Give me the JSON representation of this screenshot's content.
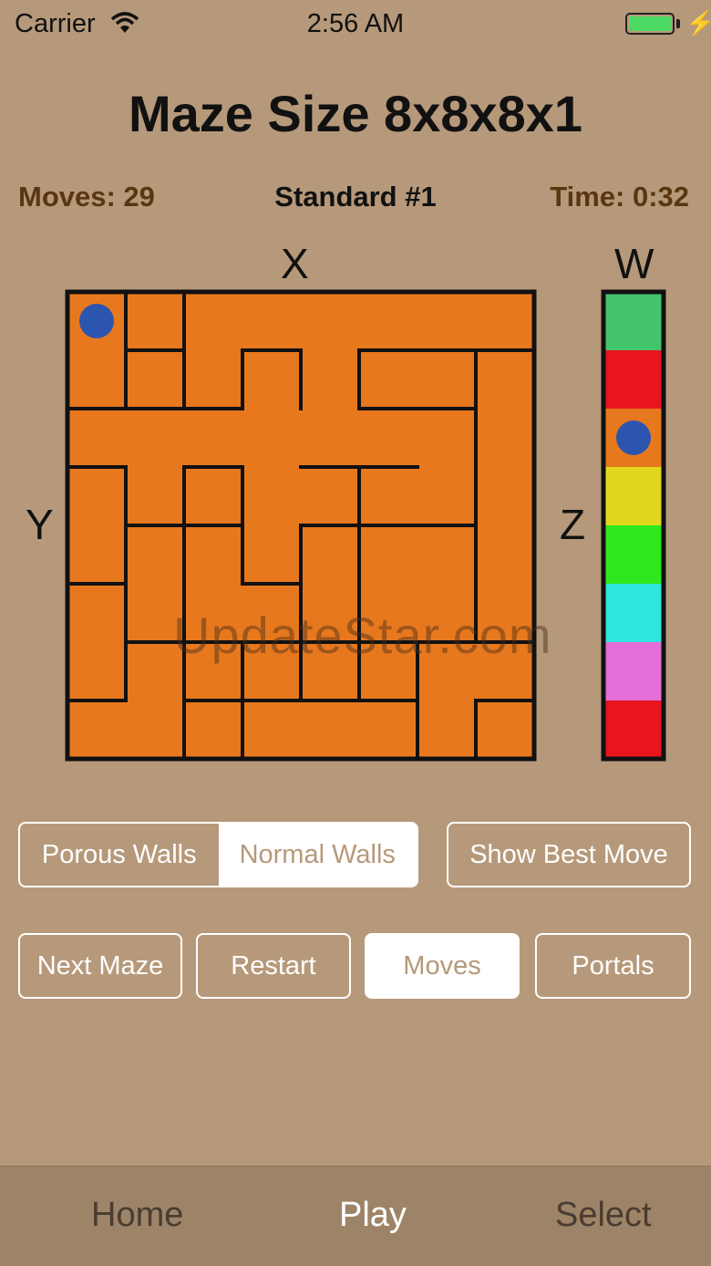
{
  "status": {
    "carrier": "Carrier",
    "time": "2:56 AM"
  },
  "header": {
    "title": "Maze Size 8x8x8x1"
  },
  "stats": {
    "moves": "Moves: 29",
    "mode": "Standard #1",
    "time": "Time: 0:32"
  },
  "axes": {
    "x": "X",
    "y": "Y",
    "z": "Z",
    "w": "W"
  },
  "maze": {
    "size": 8,
    "fill_color": "#e8781e",
    "wall_color": "#111111",
    "player_color": "#2c55b0",
    "player_cell": [
      0,
      0
    ]
  },
  "w_bar": {
    "colors": [
      "#45c46e",
      "#e8141e",
      "#e8781e",
      "#e2d71c",
      "#2ee81e",
      "#2ee6dc",
      "#e36ed8",
      "#e8141e"
    ],
    "player_level": 2
  },
  "watermark": "UpdateStar.com",
  "wall_mode": {
    "options": [
      "Porous Walls",
      "Normal Walls"
    ],
    "selected": "Normal Walls"
  },
  "buttons": {
    "show_best_move": "Show Best Move",
    "next_maze": "Next Maze",
    "restart": "Restart",
    "moves": "Moves",
    "portals": "Portals"
  },
  "tabs": [
    {
      "label": "Home",
      "active": false
    },
    {
      "label": "Play",
      "active": true
    },
    {
      "label": "Select",
      "active": false
    }
  ]
}
